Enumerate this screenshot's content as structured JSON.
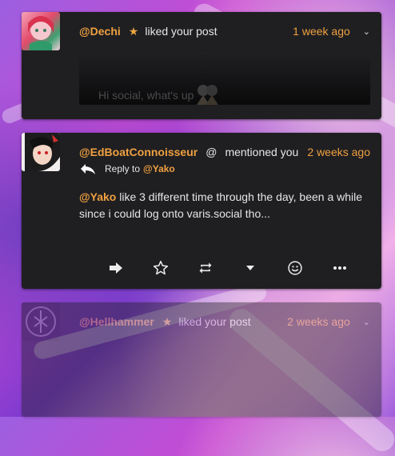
{
  "notifications": [
    {
      "username": "@Dechi",
      "action": "liked your post",
      "time": "1 week ago",
      "icon": "star-icon",
      "preview_text": "Hi social, what's up"
    },
    {
      "username": "@EdBoatConnoisseur",
      "action": "mentioned you",
      "time": "2 weeks ago",
      "icon": "at-icon",
      "reply_label": "Reply to",
      "reply_to": "@Yako",
      "mention": "@Yako",
      "body": "like 3 different time through the day, been a while since i could log onto varis.social tho..."
    },
    {
      "username": "@Hellhammer",
      "action": "liked your post",
      "time": "2 weeks ago",
      "icon": "star-icon"
    }
  ],
  "colors": {
    "card_bg": "#1f1f22",
    "accent": "#f0a040",
    "text": "#e6e6e6"
  }
}
